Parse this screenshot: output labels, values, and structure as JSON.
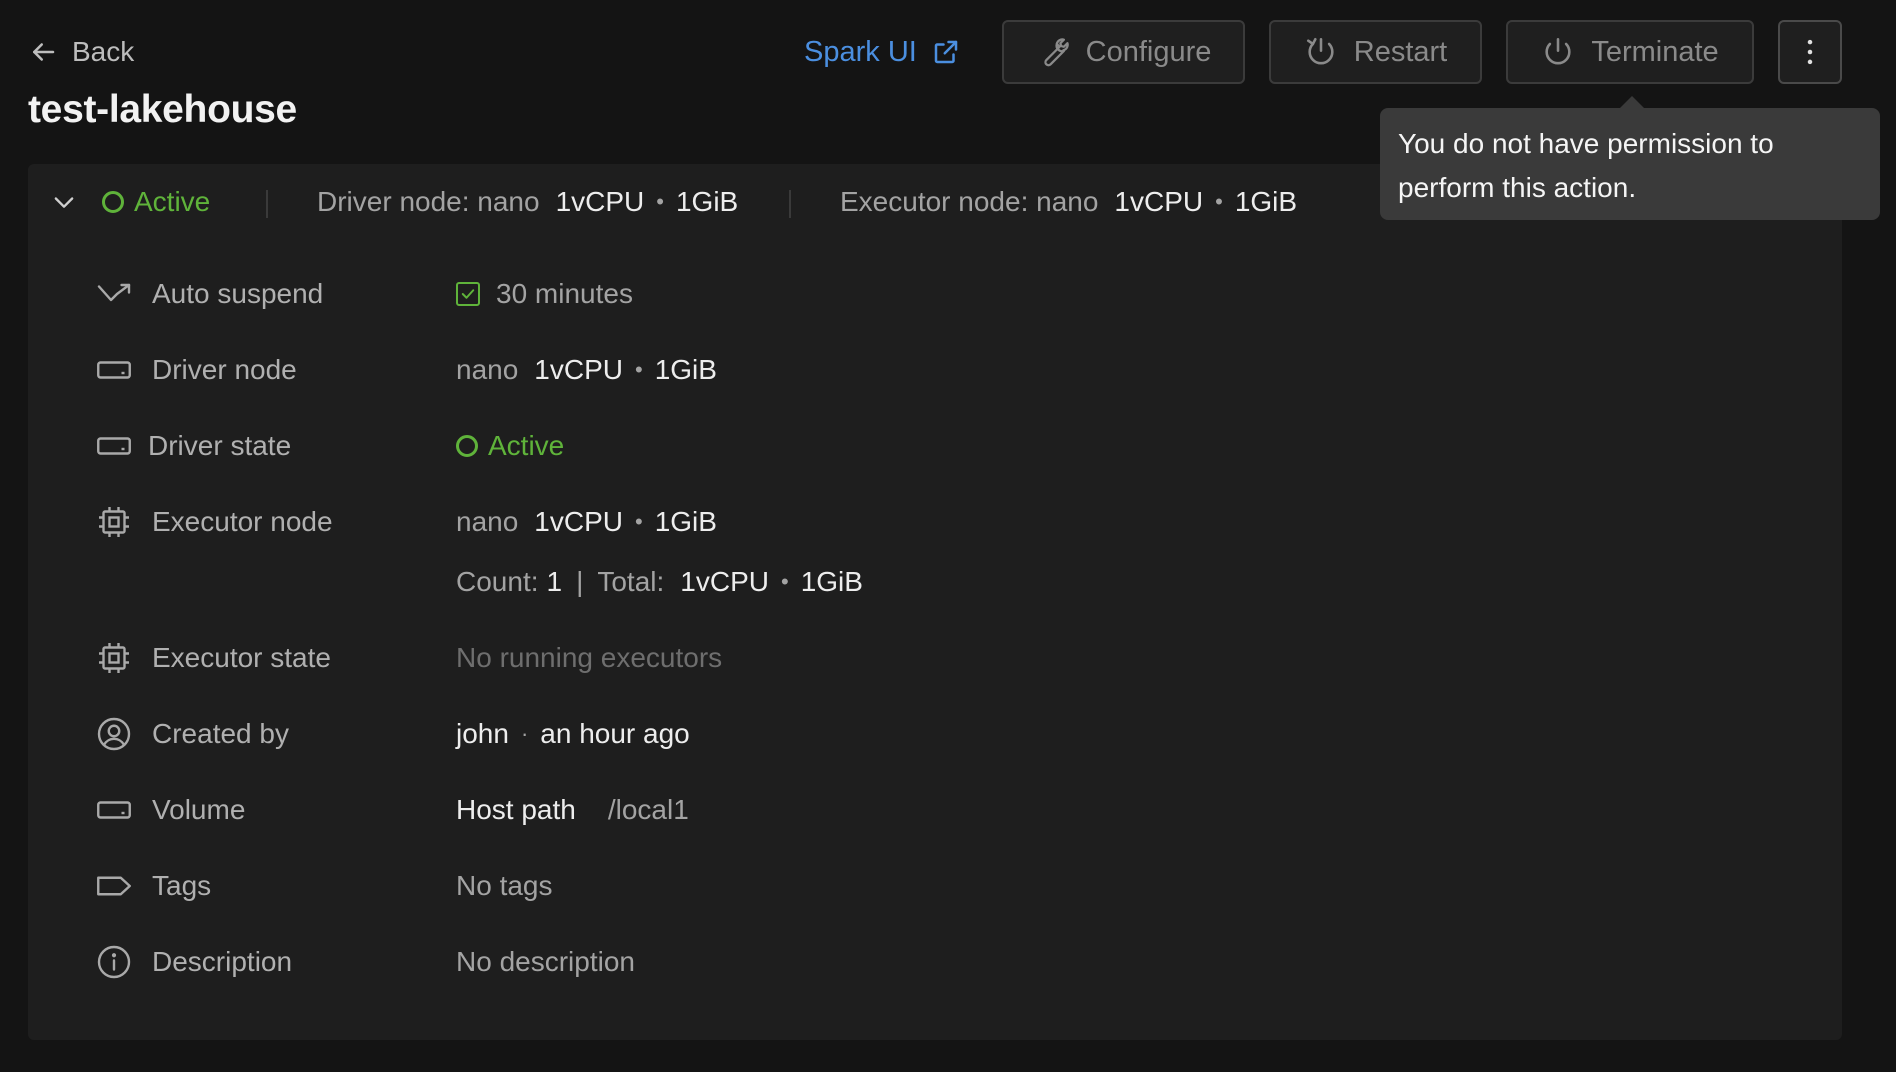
{
  "header": {
    "back_label": "Back",
    "spark_ui_label": "Spark UI",
    "configure_label": "Configure",
    "restart_label": "Restart",
    "terminate_label": "Terminate",
    "title": "test-lakehouse"
  },
  "tooltip": {
    "text": "You do not have permission to perform this action."
  },
  "summary": {
    "status": "Active",
    "driver_prefix": "Driver node: nano",
    "driver_cpu": "1vCPU",
    "driver_mem": "1GiB",
    "executor_prefix": "Executor node: nano",
    "executor_cpu": "1vCPU",
    "executor_mem": "1GiB",
    "separator_dot": "•"
  },
  "details": {
    "auto_suspend": {
      "label": "Auto suspend",
      "value": "30 minutes",
      "checked": true
    },
    "driver_node": {
      "label": "Driver node",
      "type": "nano",
      "cpu": "1vCPU",
      "mem": "1GiB"
    },
    "driver_state": {
      "label": "Driver state",
      "value": "Active"
    },
    "executor_node": {
      "label": "Executor node",
      "type": "nano",
      "cpu": "1vCPU",
      "mem": "1GiB",
      "count_label": "Count:",
      "count": "1",
      "pipe": "|",
      "total_label": "Total:",
      "total_cpu": "1vCPU",
      "total_mem": "1GiB"
    },
    "executor_state": {
      "label": "Executor state",
      "value": "No running executors"
    },
    "created_by": {
      "label": "Created by",
      "user": "john",
      "time": "an hour ago",
      "dot": "·"
    },
    "volume": {
      "label": "Volume",
      "type": "Host path",
      "path": "/local1"
    },
    "tags": {
      "label": "Tags",
      "value": "No tags"
    },
    "description": {
      "label": "Description",
      "value": "No description"
    }
  },
  "colors": {
    "accent_link": "#4b8fe0",
    "status_active": "#5fb33a",
    "background": "#141414",
    "panel": "#1e1e1e"
  }
}
